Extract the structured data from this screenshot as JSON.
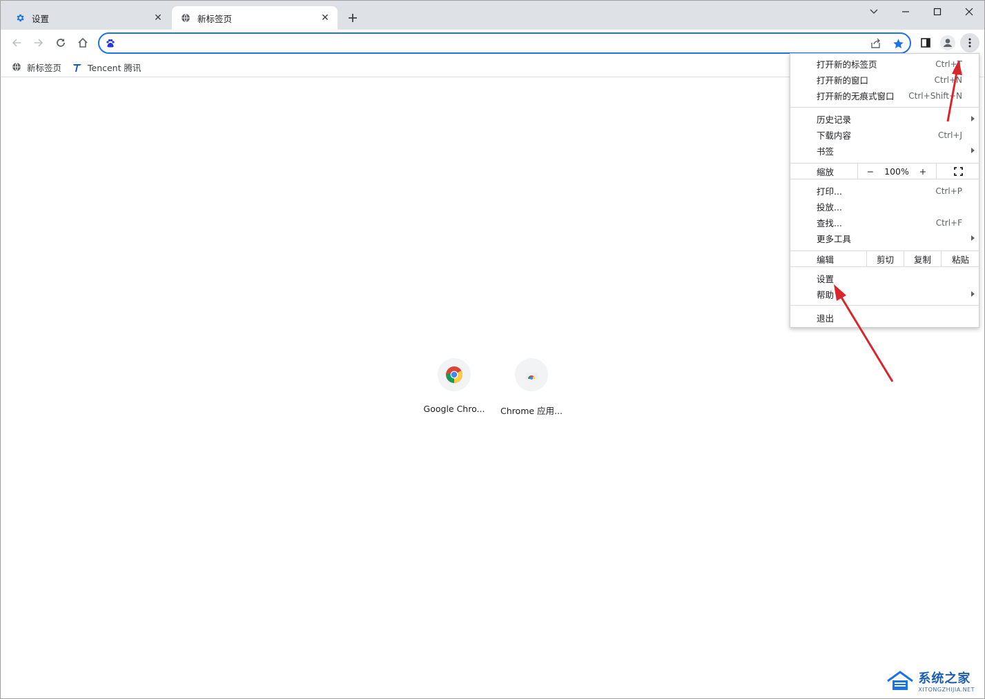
{
  "tabs": [
    {
      "label": "设置",
      "icon": "gear-icon",
      "active": false
    },
    {
      "label": "新标签页",
      "icon": "globe-icon",
      "active": true
    }
  ],
  "toolbar": {
    "omnibox_value": "",
    "search_engine_icon": "baidu-paw-icon"
  },
  "bookmarks": [
    {
      "label": "新标签页",
      "icon": "globe-icon"
    },
    {
      "label": "Tencent 腾讯",
      "icon": "tencent-icon"
    }
  ],
  "shortcuts": [
    {
      "label": "Google Chro...",
      "icon": "chrome-icon"
    },
    {
      "label": "Chrome 应用...",
      "icon": "chrome-web-store-icon"
    }
  ],
  "menu": {
    "new_tab": {
      "label": "打开新的标签页",
      "shortcut": "Ctrl+T"
    },
    "new_window": {
      "label": "打开新的窗口",
      "shortcut": "Ctrl+N"
    },
    "new_incognito": {
      "label": "打开新的无痕式窗口",
      "shortcut": "Ctrl+Shift+N"
    },
    "history": {
      "label": "历史记录"
    },
    "downloads": {
      "label": "下载内容",
      "shortcut": "Ctrl+J"
    },
    "bookmarks": {
      "label": "书签"
    },
    "zoom": {
      "label": "缩放",
      "minus": "−",
      "value": "100%",
      "plus": "+"
    },
    "print": {
      "label": "打印...",
      "shortcut": "Ctrl+P"
    },
    "cast": {
      "label": "投放..."
    },
    "find": {
      "label": "查找...",
      "shortcut": "Ctrl+F"
    },
    "more_tools": {
      "label": "更多工具"
    },
    "edit": {
      "label": "编辑",
      "cut": "剪切",
      "copy": "复制",
      "paste": "粘贴"
    },
    "settings": {
      "label": "设置"
    },
    "help": {
      "label": "帮助"
    },
    "exit": {
      "label": "退出"
    }
  },
  "watermark": {
    "title": "系统之家",
    "subtitle": "XITONGZHIJIA.NET"
  },
  "colors": {
    "accent": "#1a73e8",
    "annotation_arrow": "#d9262a",
    "tabstrip": "#dee1e6"
  }
}
